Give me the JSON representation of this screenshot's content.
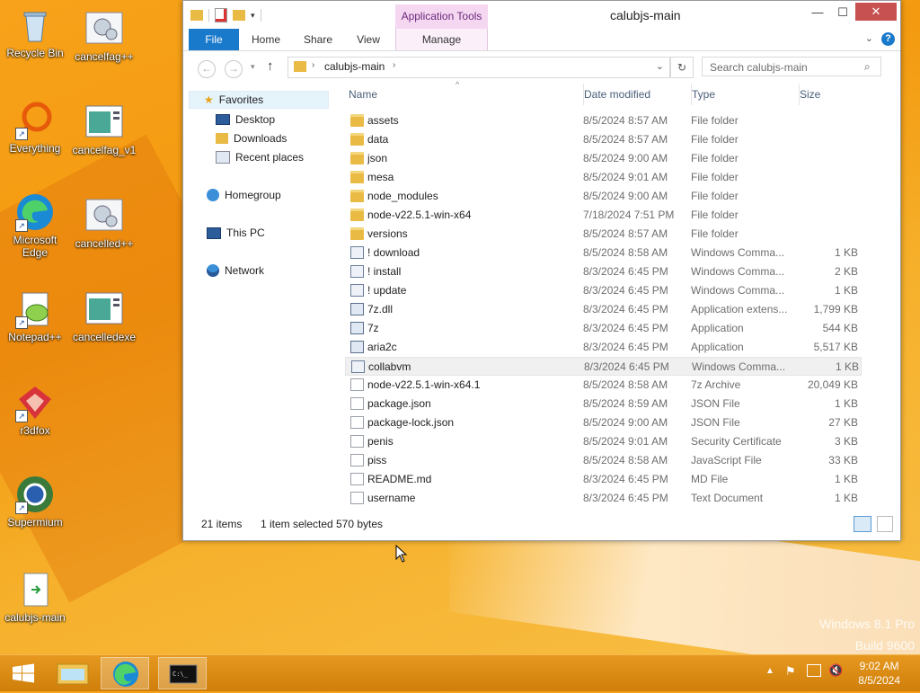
{
  "desktop": {
    "icons": [
      {
        "label": "Recycle Bin"
      },
      {
        "label": "cancelfag++"
      },
      {
        "label": "Everything"
      },
      {
        "label": "cancelfag_v1"
      },
      {
        "label": "Microsoft Edge"
      },
      {
        "label": "cancelled++"
      },
      {
        "label": "Notepad++"
      },
      {
        "label": "cancelledexe"
      },
      {
        "label": "r3dfox"
      },
      {
        "label": "Supermium"
      },
      {
        "label": "calubjs-main"
      }
    ],
    "watermark_line1": "Windows 8.1 Pro",
    "watermark_line2": "Build 9600"
  },
  "window": {
    "title": "calubjs-main",
    "app_tools": "Application Tools",
    "tabs": [
      "File",
      "Home",
      "Share",
      "View",
      "Manage"
    ],
    "address": [
      "calubjs-main"
    ],
    "search_placeholder": "Search calubjs-main",
    "nav": {
      "favorites": "Favorites",
      "desktop": "Desktop",
      "downloads": "Downloads",
      "recent": "Recent places",
      "homegroup": "Homegroup",
      "thispc": "This PC",
      "network": "Network"
    },
    "columns": {
      "name": "Name",
      "date": "Date modified",
      "type": "Type",
      "size": "Size"
    },
    "files": [
      {
        "name": "assets",
        "date": "8/5/2024 8:57 AM",
        "type": "File folder",
        "size": "",
        "icon": "folder"
      },
      {
        "name": "data",
        "date": "8/5/2024 8:57 AM",
        "type": "File folder",
        "size": "",
        "icon": "folder"
      },
      {
        "name": "json",
        "date": "8/5/2024 9:00 AM",
        "type": "File folder",
        "size": "",
        "icon": "folder"
      },
      {
        "name": "mesa",
        "date": "8/5/2024 9:01 AM",
        "type": "File folder",
        "size": "",
        "icon": "folder"
      },
      {
        "name": "node_modules",
        "date": "8/5/2024 9:00 AM",
        "type": "File folder",
        "size": "",
        "icon": "folder"
      },
      {
        "name": "node-v22.5.1-win-x64",
        "date": "7/18/2024 7:51 PM",
        "type": "File folder",
        "size": "",
        "icon": "folder"
      },
      {
        "name": "versions",
        "date": "8/5/2024 8:57 AM",
        "type": "File folder",
        "size": "",
        "icon": "folder"
      },
      {
        "name": "! download",
        "date": "8/5/2024 8:58 AM",
        "type": "Windows Comma...",
        "size": "1 KB",
        "icon": "cmd"
      },
      {
        "name": "! install",
        "date": "8/3/2024 6:45 PM",
        "type": "Windows Comma...",
        "size": "2 KB",
        "icon": "cmd"
      },
      {
        "name": "! update",
        "date": "8/3/2024 6:45 PM",
        "type": "Windows Comma...",
        "size": "1 KB",
        "icon": "cmd"
      },
      {
        "name": "7z.dll",
        "date": "8/3/2024 6:45 PM",
        "type": "Application extens...",
        "size": "1,799 KB",
        "icon": "app"
      },
      {
        "name": "7z",
        "date": "8/3/2024 6:45 PM",
        "type": "Application",
        "size": "544 KB",
        "icon": "app"
      },
      {
        "name": "aria2c",
        "date": "8/3/2024 6:45 PM",
        "type": "Application",
        "size": "5,517 KB",
        "icon": "app"
      },
      {
        "name": "collabvm",
        "date": "8/3/2024 6:45 PM",
        "type": "Windows Comma...",
        "size": "1 KB",
        "icon": "cmd",
        "selected": true
      },
      {
        "name": "node-v22.5.1-win-x64.1",
        "date": "8/5/2024 8:58 AM",
        "type": "7z Archive",
        "size": "20,049 KB",
        "icon": "doc"
      },
      {
        "name": "package.json",
        "date": "8/5/2024 8:59 AM",
        "type": "JSON File",
        "size": "1 KB",
        "icon": "doc"
      },
      {
        "name": "package-lock.json",
        "date": "8/5/2024 9:00 AM",
        "type": "JSON File",
        "size": "27 KB",
        "icon": "doc"
      },
      {
        "name": "penis",
        "date": "8/5/2024 9:01 AM",
        "type": "Security Certificate",
        "size": "3 KB",
        "icon": "doc"
      },
      {
        "name": "piss",
        "date": "8/5/2024 8:58 AM",
        "type": "JavaScript File",
        "size": "33 KB",
        "icon": "doc"
      },
      {
        "name": "README.md",
        "date": "8/3/2024 6:45 PM",
        "type": "MD File",
        "size": "1 KB",
        "icon": "doc"
      },
      {
        "name": "username",
        "date": "8/3/2024 6:45 PM",
        "type": "Text Document",
        "size": "1 KB",
        "icon": "doc"
      }
    ],
    "status": {
      "count": "21 items",
      "selected": "1 item selected",
      "bytes": "570 bytes"
    }
  },
  "taskbar": {
    "time": "9:02 AM",
    "date": "8/5/2024"
  },
  "colors": {
    "accent": "#1979ca",
    "desktop": "#f39a10",
    "close": "#c75050"
  }
}
